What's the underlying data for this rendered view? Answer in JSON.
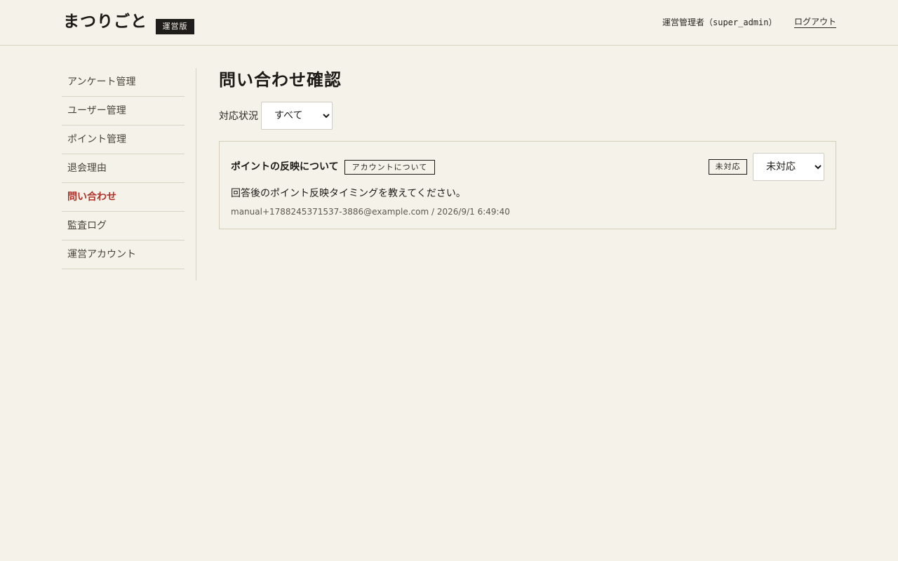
{
  "header": {
    "logo": "まつりごと",
    "edition_badge": "運営版",
    "user_info": "運営管理者（super_admin）",
    "logout_label": "ログアウト"
  },
  "sidebar": {
    "items": [
      {
        "label": "アンケート管理",
        "active": false
      },
      {
        "label": "ユーザー管理",
        "active": false
      },
      {
        "label": "ポイント管理",
        "active": false
      },
      {
        "label": "退会理由",
        "active": false
      },
      {
        "label": "問い合わせ",
        "active": true
      },
      {
        "label": "監査ログ",
        "active": false
      },
      {
        "label": "運営アカウント",
        "active": false
      }
    ]
  },
  "main": {
    "title": "問い合わせ確認",
    "filter": {
      "label": "対応状況",
      "selected": "すべて"
    },
    "inquiries": [
      {
        "subject": "ポイントの反映について",
        "category": "アカウントについて",
        "status": "未対応",
        "status_select": "未対応",
        "message": "回答後のポイント反映タイミングを教えてください。",
        "email": "manual+1788245371537-3886@example.com",
        "datetime": "2026/9/1 6:49:40",
        "meta": "manual+1788245371537-3886@example.com / 2026/9/1 6:49:40"
      }
    ]
  },
  "colors": {
    "background": "#f5f2ea",
    "active_nav": "#b0322a",
    "badge_dark": "#1f1d1a",
    "border": "#d9d3c3"
  }
}
